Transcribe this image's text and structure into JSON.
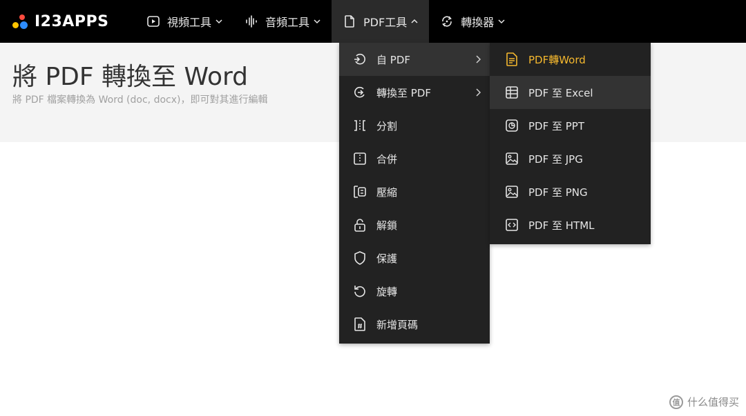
{
  "logo": {
    "text": "I23APPS"
  },
  "nav": [
    {
      "label": "視頻工具",
      "icon": "play-icon"
    },
    {
      "label": "音頻工具",
      "icon": "audio-wave-icon"
    },
    {
      "label": "PDF工具",
      "icon": "document-icon"
    },
    {
      "label": "轉換器",
      "icon": "convert-icon"
    }
  ],
  "hero": {
    "title": "將 PDF 轉換至 Word",
    "subtitle": "將 PDF 檔案轉換為 Word (doc, docx)，即可對其進行編輯"
  },
  "pdf_menu": [
    {
      "label": "自 PDF",
      "icon": "from-pdf-icon",
      "has_submenu": true
    },
    {
      "label": "轉換至 PDF",
      "icon": "to-pdf-icon",
      "has_submenu": true
    },
    {
      "label": "分割",
      "icon": "split-icon"
    },
    {
      "label": "合併",
      "icon": "merge-icon"
    },
    {
      "label": "壓縮",
      "icon": "compress-icon"
    },
    {
      "label": "解鎖",
      "icon": "unlock-icon"
    },
    {
      "label": "保護",
      "icon": "shield-icon"
    },
    {
      "label": "旋轉",
      "icon": "rotate-icon"
    },
    {
      "label": "新增頁碼",
      "icon": "page-number-icon"
    }
  ],
  "from_pdf_submenu": [
    {
      "label": "PDF轉Word",
      "icon": "word-doc-icon"
    },
    {
      "label": "PDF 至 Excel",
      "icon": "table-icon"
    },
    {
      "label": "PDF 至 PPT",
      "icon": "ppt-icon"
    },
    {
      "label": "PDF 至 JPG",
      "icon": "image-icon"
    },
    {
      "label": "PDF 至 PNG",
      "icon": "image-icon"
    },
    {
      "label": "PDF 至 HTML",
      "icon": "html-icon"
    }
  ],
  "watermark": {
    "text": "什么值得买",
    "badge": "值"
  },
  "colors": {
    "accent": "#f5b82e",
    "topbar": "#000000",
    "menu_bg": "#222222",
    "hover_bg": "#333333"
  }
}
